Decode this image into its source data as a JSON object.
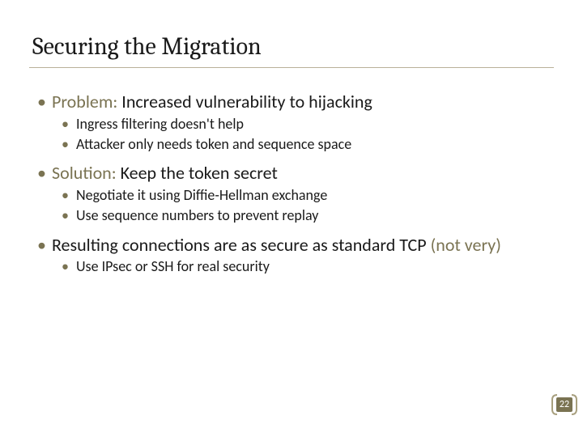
{
  "title": "Securing the Migration",
  "bullets": {
    "b0": {
      "accent": "Problem: ",
      "rest": "Increased vulnerability to hijacking",
      "sub": [
        "Ingress filtering doesn't help",
        "Attacker only needs token and sequence space"
      ]
    },
    "b1": {
      "accent": "Solution: ",
      "rest": "Keep the token secret",
      "sub": [
        "Negotiate it using Diffie-Hellman exchange",
        "Use sequence numbers to prevent replay"
      ]
    },
    "b2": {
      "plain_a": "Resulting connections are as secure as standard TCP ",
      "accent_b": "(not very)",
      "sub": [
        "Use IPsec or SSH for real security"
      ]
    }
  },
  "page_number": "22"
}
